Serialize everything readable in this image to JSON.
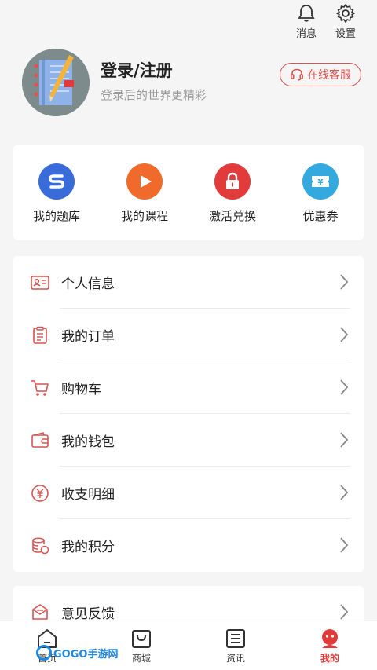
{
  "header": {
    "messages_label": "消息",
    "settings_label": "设置"
  },
  "profile": {
    "title": "登录/注册",
    "subtitle": "登录后的世界更精彩",
    "service_label": "在线客服"
  },
  "quick_actions": [
    {
      "label": "我的题库",
      "icon": "question-bank-icon",
      "color": "#3a6cd9"
    },
    {
      "label": "我的课程",
      "icon": "play-course-icon",
      "color": "#ef6a2b"
    },
    {
      "label": "激活兑换",
      "icon": "lock-icon",
      "color": "#e23b3b"
    },
    {
      "label": "优惠券",
      "icon": "coupon-icon",
      "color": "#34a9e0"
    }
  ],
  "menu": [
    {
      "label": "个人信息",
      "icon": "id-card-icon"
    },
    {
      "label": "我的订单",
      "icon": "order-icon"
    },
    {
      "label": "购物车",
      "icon": "cart-icon"
    },
    {
      "label": "我的钱包",
      "icon": "wallet-icon"
    },
    {
      "label": "收支明细",
      "icon": "yuan-icon"
    },
    {
      "label": "我的积分",
      "icon": "coins-icon"
    }
  ],
  "menu2": [
    {
      "label": "意见反馈",
      "icon": "feedback-icon"
    }
  ],
  "tabbar": [
    {
      "label": "首页",
      "icon": "home-icon",
      "active": false
    },
    {
      "label": "商城",
      "icon": "shop-bag-icon",
      "active": false
    },
    {
      "label": "资讯",
      "icon": "news-icon",
      "active": false
    },
    {
      "label": "我的",
      "icon": "profile-icon",
      "active": true
    }
  ],
  "watermark": {
    "text": "GOGO手游网"
  },
  "colors": {
    "accent": "#e03a3a",
    "icon_red": "#d9534f"
  }
}
